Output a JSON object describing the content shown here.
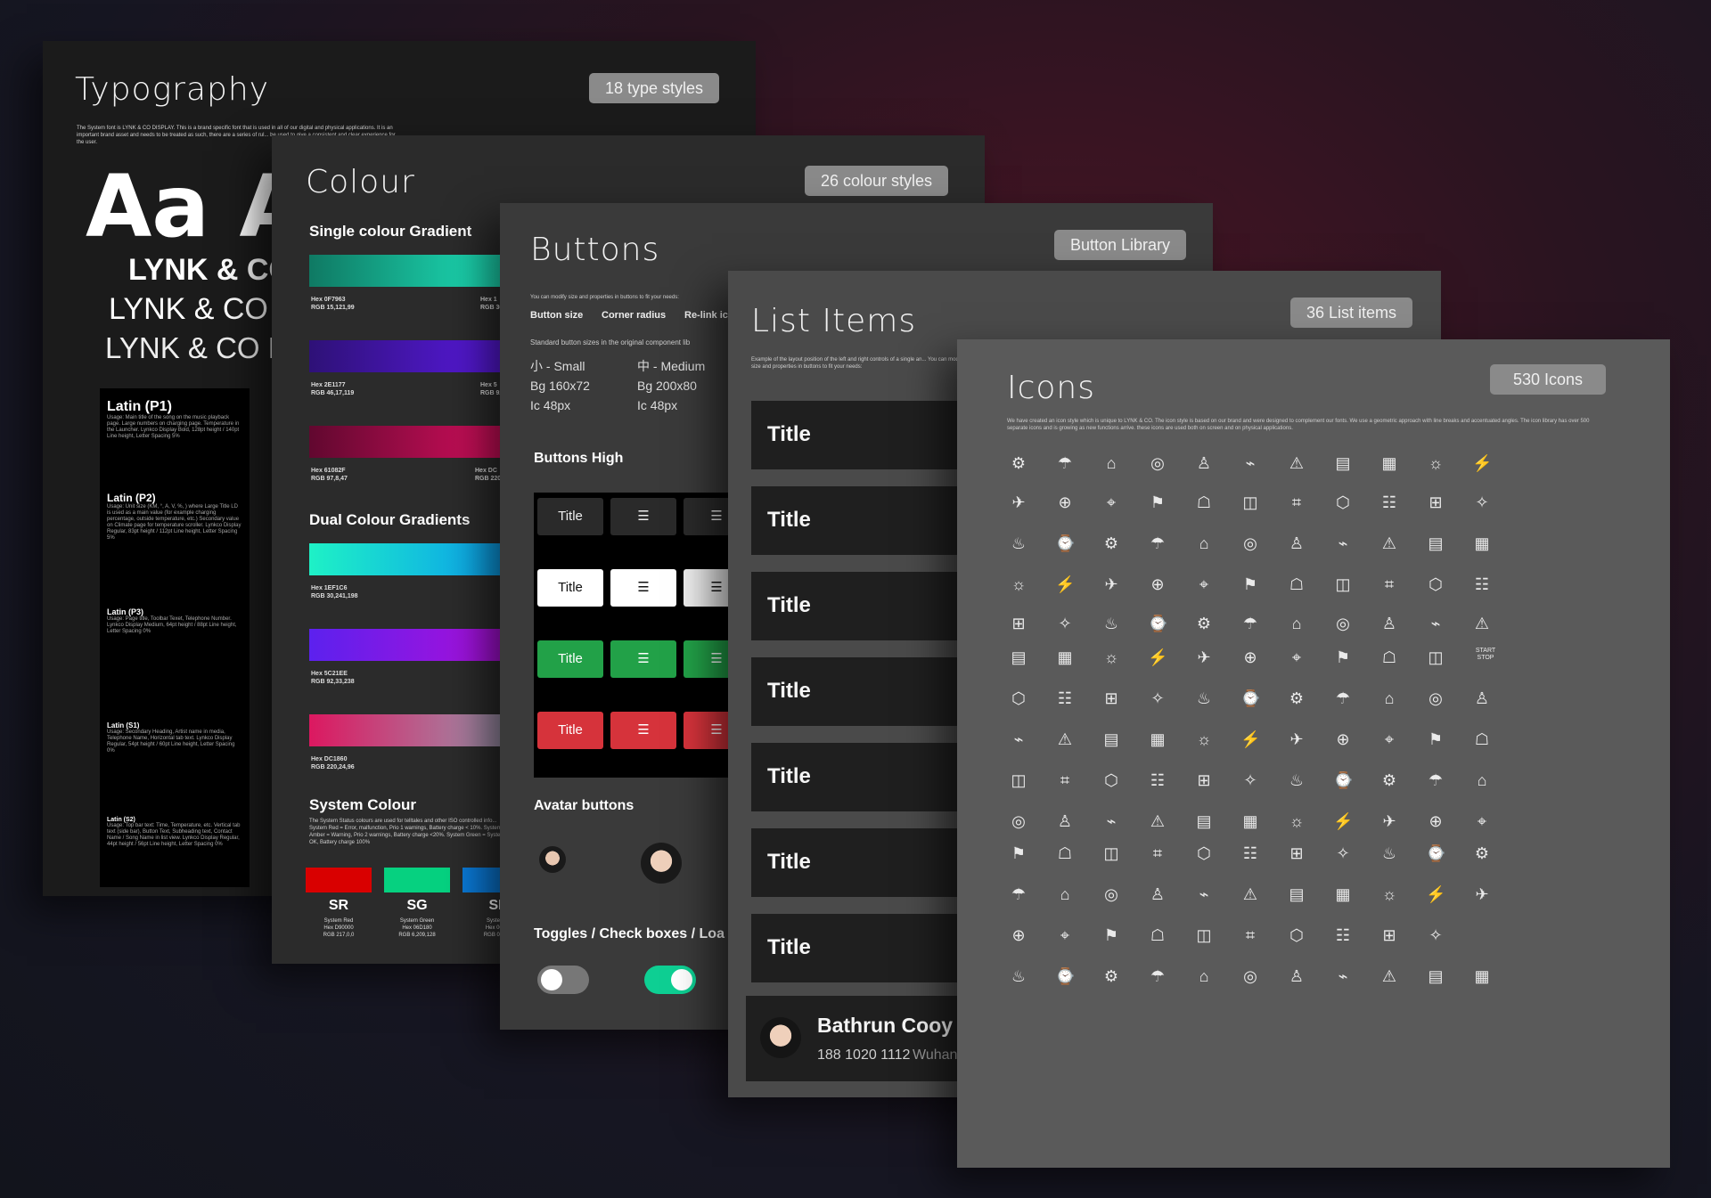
{
  "typography": {
    "title": "Typography",
    "badge": "18 type styles",
    "intro": "The System font is LYNK & CO DISPLAY. This is a brand specific font that is used in all of our digital and physical applications. It is an important brand asset and needs to be treated as such, there are a series of rul... be used to give a consistent and clear experience for the user.",
    "sample": "Aa Aa",
    "lynk_bold": "LYNK & CO",
    "lynk_medium": "LYNK & CO",
    "lynk_light": "LYNK & CO D",
    "latin": [
      {
        "name": "Latin (P1)",
        "body": "Usage: Main title of the song on the music playback page. Large numbers on charging page. Temperature in the Launcher. Lynkco Display Bold, 128pt height / 140pt Line height, Letter Spacing 5%"
      },
      {
        "name": "Latin (P2)",
        "body": "Usage: Unit size (KM, °, A, V, %, ) where Large Title LD is used as a main value (for example charging percentage, outside temperature, etc.) Secondary value on Climate page for temperature scroller. Lynkco Display Regular, 83pt height / 112pt Line height, Letter Spacing 5%"
      },
      {
        "name": "Latin (P3)",
        "body": "Usage: Page title, Toolbar Texet, Telephone Number. Lynkco Display Medium, 64pt height / 88pt Line height, Letter Spacing 0%"
      },
      {
        "name": "Latin (S1)",
        "body": "Usage: Secondary Heading, Artist name in media, Telephone Name, Horizontal tab text. Lynkco Display Regular, 54pt height / 60pt Line height, Letter Spacing 0%"
      },
      {
        "name": "Latin (S2)",
        "body": "Usage: Top bar text: Time, Temperature, etc. Vertical tab text (side bar), Button Text, Subheading text, Contact Name / Song Name in list view. Lynkco Display Regular, 44pt height / 56pt Line height, Letter Spacing 0%"
      }
    ]
  },
  "colour": {
    "title": "Colour",
    "badge": "26 colour styles",
    "single_heading": "Single colour Gradient",
    "single": [
      {
        "hex": "Hex 0F7963",
        "rgb": "RGB 15,121,99",
        "partial": "Hex 1",
        "partial2": "RGB 30,",
        "from": "#0f7963",
        "to": "#1ee9c0"
      },
      {
        "hex": "Hex 2E1177",
        "rgb": "RGB 46,17,119",
        "partial": "Hex 5",
        "partial2": "RGB 92,",
        "from": "#2e1177",
        "to": "#5c1ae6"
      },
      {
        "hex": "Hex 61082F",
        "rgb": "RGB 97,8,47",
        "partial": "Hex DC",
        "partial2": "RGB 220",
        "from": "#61082f",
        "to": "#dc1060"
      }
    ],
    "dual_heading": "Dual Colour Gradients",
    "dual": [
      {
        "hex": "Hex 1EF1C6",
        "rgb": "RGB 30,241,198",
        "from": "#1ef1c6",
        "to": "#0a9aef"
      },
      {
        "hex": "Hex 5C21EE",
        "rgb": "RGB 92,33,238",
        "from": "#5c21ee",
        "to": "#b10fd8"
      },
      {
        "hex": "Hex DC1860",
        "rgb": "RGB 220,24,96",
        "from": "#dc1860",
        "to": "#9a9ab0"
      }
    ],
    "system_heading": "System Colour",
    "system_desc": "The System Status colours are used for telltales and other ISO controlled info... System Red = Error, malfunction, Prio 1 warnings, Battery charge < 10%. System Amber = Warning, Prio 2 warnings, Battery charge <20%. System Green = System OK, Battery charge 100%",
    "system": [
      {
        "label": "SR",
        "name": "System Red",
        "hex": "Hex D90000",
        "rgb": "RGB 217,0,0",
        "color": "#d90000"
      },
      {
        "label": "SG",
        "name": "System Green",
        "hex": "Hex 06D180",
        "rgb": "RGB 6,209,128",
        "color": "#06d180"
      },
      {
        "label": "SI",
        "name": "System",
        "hex": "Hex 009",
        "rgb": "RGB 0,14",
        "color": "#0a7ad8"
      }
    ]
  },
  "buttons": {
    "title": "Buttons",
    "badge": "Button Library",
    "note": "You can modify size and properties in buttons to fit your needs:",
    "props": [
      "Button size",
      "Corner radius",
      "Re-link ic"
    ],
    "sizes_note": "Standard button sizes in the original component lib",
    "small": [
      "小 - Small",
      "Bg 160x72",
      "Ic 48px"
    ],
    "medium": [
      "中 - Medium",
      "Bg 200x80",
      "Ic 48px"
    ],
    "high_heading": "Buttons High",
    "title_label": "Title",
    "avatar_heading": "Avatar buttons",
    "toggles_heading": "Toggles / Check boxes / Loa",
    "colors": {
      "green": "#22a148",
      "red": "#d6333b",
      "toggle_on": "#0ecf93"
    }
  },
  "list": {
    "title": "List Items",
    "badge": "36 List items",
    "note": "Example of the layout position of the left and right controls of a single an... You can modify size and properties in buttons to fit your needs:",
    "items": [
      "Title",
      "Title",
      "Title",
      "Title",
      "Title",
      "Title",
      "Title"
    ],
    "contact_name": "Bathrun Cooy",
    "contact_phone": "188 1020 1112",
    "contact_city": "Wuhan"
  },
  "icons": {
    "title": "Icons",
    "badge": "530 Icons",
    "note": "We have created an icon style which is unique to LYNK & CO. The icon style is based on our brand and were designed to complement our fonts. We use a geometric approach with line breaks and accentuated angles. The icon library has over 500 separate icons and is growing as new functions arrive. these icons are used both on screen and on physical applications.",
    "start_stop": "START STOP"
  }
}
